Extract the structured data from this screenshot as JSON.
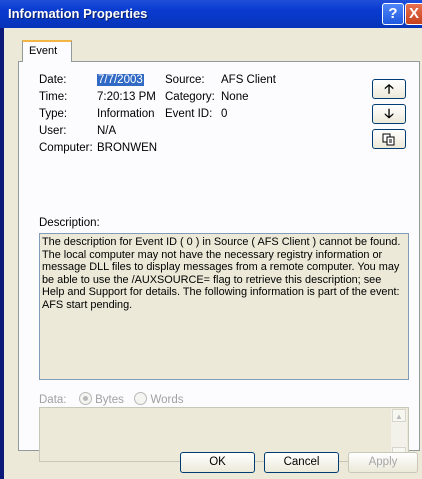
{
  "window": {
    "title": "Information Properties",
    "help_icon": "?",
    "close_icon": "X"
  },
  "tabs": [
    {
      "label": "Event"
    }
  ],
  "event": {
    "date_label": "Date:",
    "date_value": "7/7/2003",
    "time_label": "Time:",
    "time_value": "7:20:13 PM",
    "type_label": "Type:",
    "type_value": "Information",
    "user_label": "User:",
    "user_value": "N/A",
    "computer_label": "Computer:",
    "computer_value": "BRONWEN",
    "source_label": "Source:",
    "source_value": "AFS Client",
    "category_label": "Category:",
    "category_value": "None",
    "eventid_label": "Event ID:",
    "eventid_value": "0"
  },
  "side_buttons": {
    "up": "up-arrow-icon",
    "down": "down-arrow-icon",
    "copy": "copy-icon"
  },
  "description": {
    "label": "Description:",
    "lines": [
      "The description for Event ID ( 0 ) in Source ( AFS Client ) cannot be found.",
      "The local computer may not have the necessary registry information or",
      "message DLL files to display messages from a remote computer. You may",
      "be able to use the /AUXSOURCE= flag to retrieve this description; see",
      "Help and Support for details. The following information is part of the event:",
      "AFS start pending."
    ]
  },
  "data": {
    "label": "Data:",
    "bytes_label": "Bytes",
    "words_label": "Words",
    "selected": "Bytes"
  },
  "buttons": {
    "ok": "OK",
    "cancel": "Cancel",
    "apply": "Apply"
  }
}
